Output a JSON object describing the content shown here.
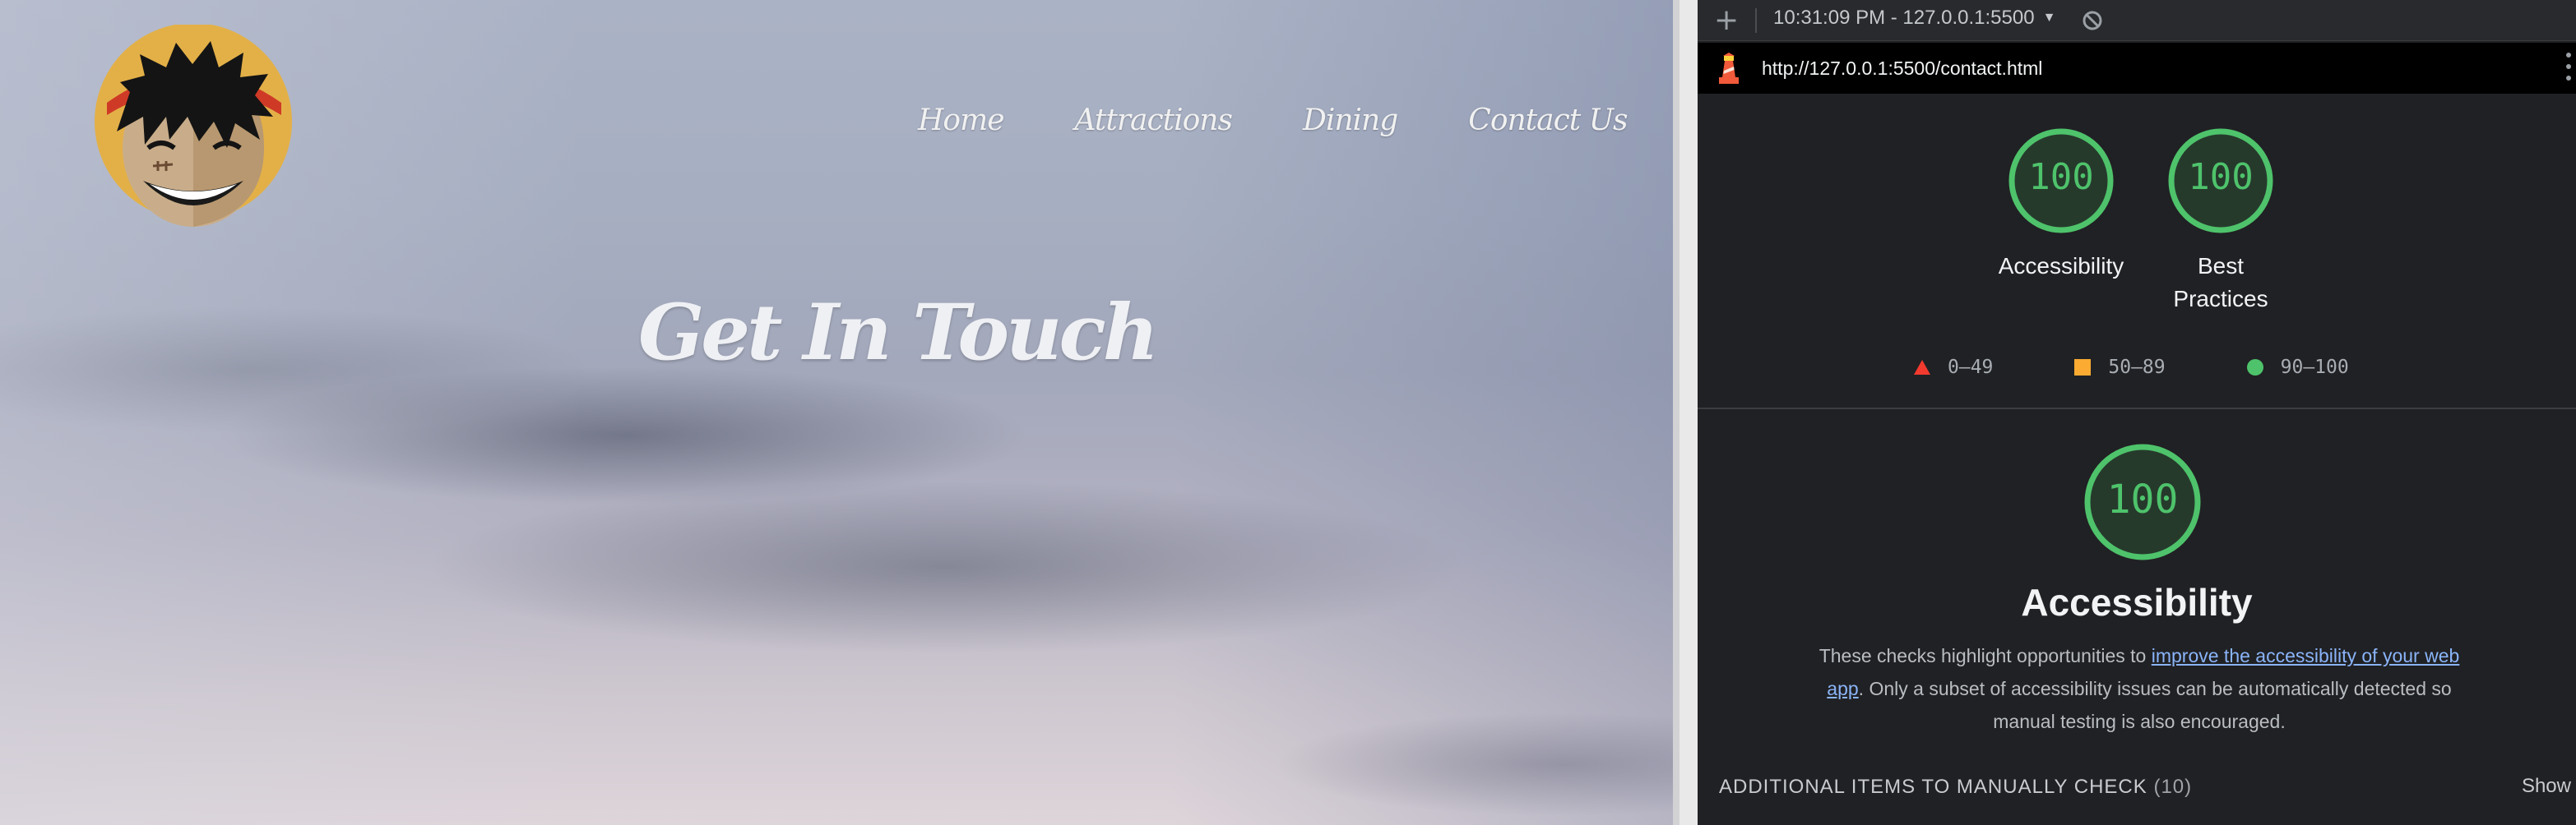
{
  "site": {
    "nav": [
      "Home",
      "Attractions",
      "Dining",
      "Contact Us"
    ],
    "hero_title": "Get In Touch"
  },
  "devtools": {
    "toolbar": {
      "add_icon": "plus-icon",
      "report_selector": "10:31:09 PM - 127.0.0.1:5500",
      "clear_icon": "block-icon"
    },
    "url": "http://127.0.0.1:5500/contact.html",
    "scores": [
      {
        "label": "Accessibility",
        "score": "100"
      },
      {
        "label": "Best Practices",
        "score": "100"
      }
    ],
    "legend": [
      {
        "range": "0–49",
        "shape": "triangle",
        "color": "#f33a2f"
      },
      {
        "range": "50–89",
        "shape": "square",
        "color": "#fbab32"
      },
      {
        "range": "90–100",
        "shape": "circle",
        "color": "#4ec36b"
      }
    ],
    "section": {
      "score": "100",
      "title": "Accessibility",
      "description_before": "These checks highlight opportunities to ",
      "description_link": "improve the accessibility of your web app",
      "description_after": ". Only a subset of accessibility issues can be automatically detected so manual testing is also encouraged.",
      "manual_label": "ADDITIONAL ITEMS TO MANUALLY CHECK",
      "manual_count": "(10)",
      "show_label": "Show"
    },
    "colors": {
      "pass": "#4ec36b",
      "link": "#8ab4f8"
    }
  }
}
